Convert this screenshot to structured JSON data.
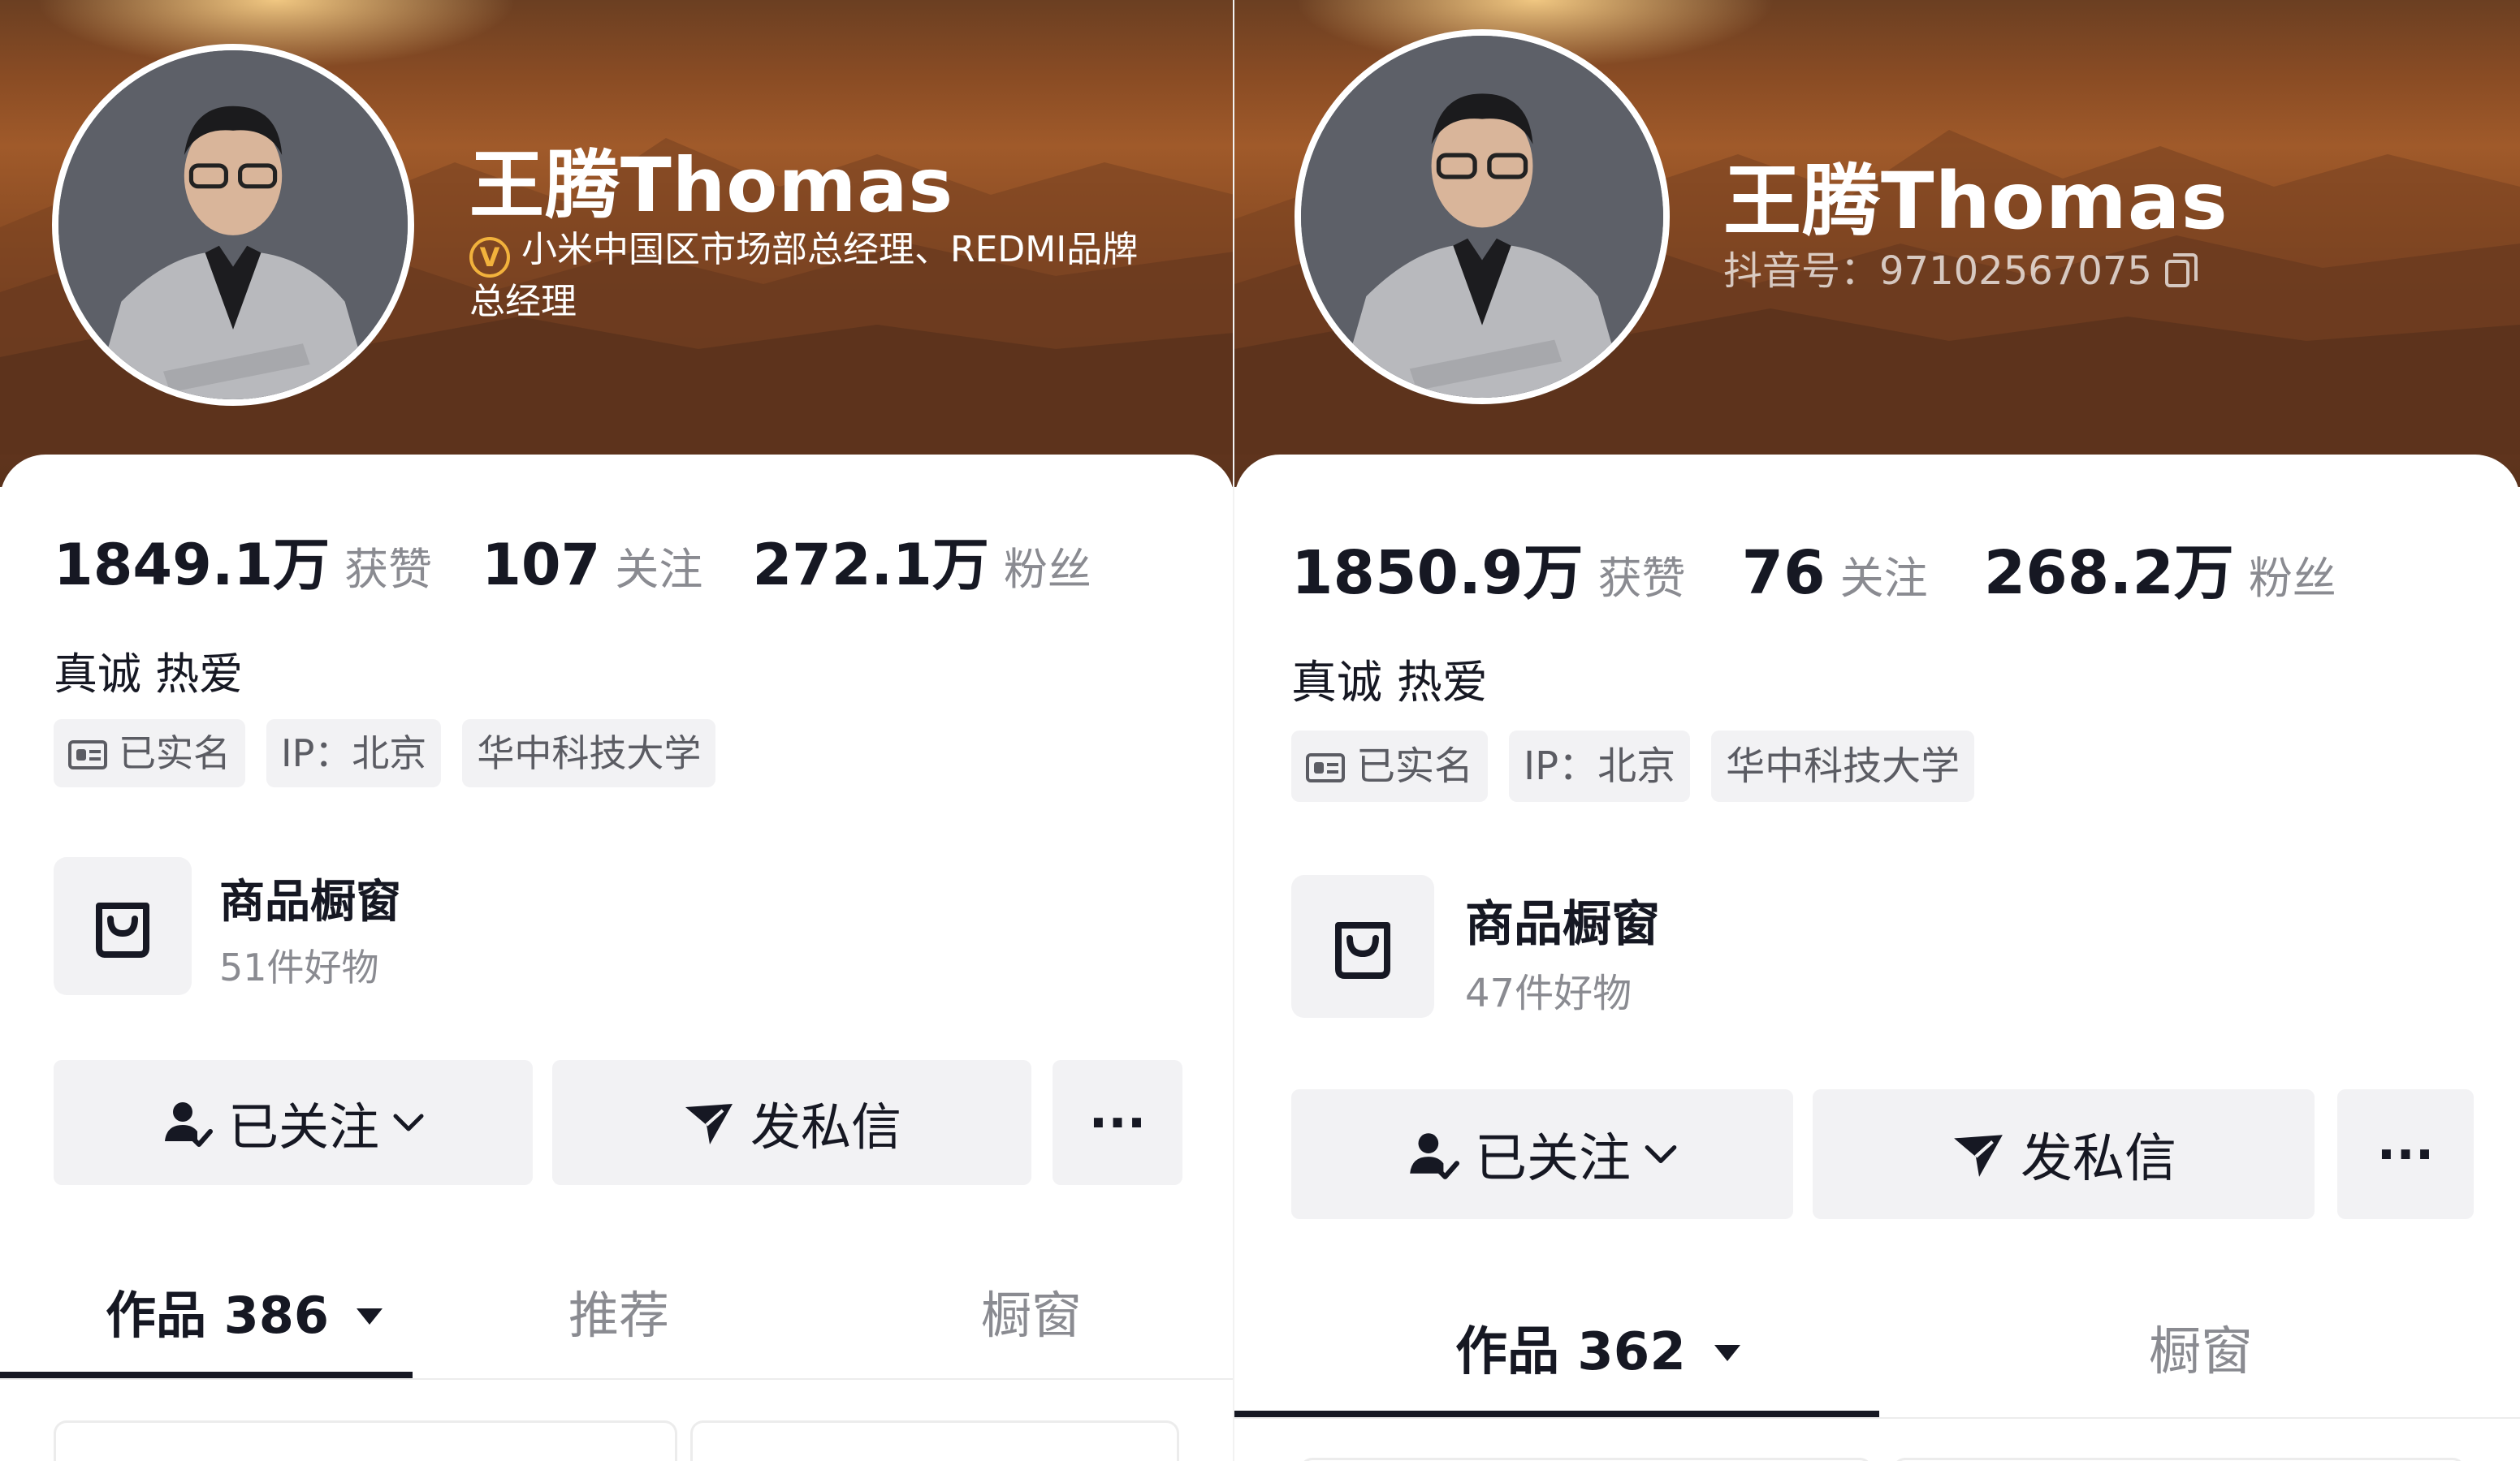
{
  "left": {
    "name": "王腾Thomas",
    "verified_mark": "V",
    "verification_text": "小米中国区市场部总经理、REDMI品牌总经理",
    "stats": [
      {
        "value": "1849.1万",
        "label": "获赞"
      },
      {
        "value": "107",
        "label": "关注"
      },
      {
        "value": "272.1万",
        "label": "粉丝"
      }
    ],
    "motto": "真诚 热爱",
    "tags": [
      "已实名",
      "IP：北京",
      "华中科技大学"
    ],
    "shop": {
      "title": "商品橱窗",
      "count": "51件好物"
    },
    "buttons": {
      "follow": "已关注",
      "message": "发私信",
      "more": "···"
    },
    "tabs": [
      {
        "label": "作品 386",
        "active": true
      },
      {
        "label": "推荐",
        "active": false
      },
      {
        "label": "橱窗",
        "active": false
      }
    ]
  },
  "right": {
    "name": "王腾Thomas",
    "douyin_id": "抖音号：97102567075",
    "stats": [
      {
        "value": "1850.9万",
        "label": "获赞"
      },
      {
        "value": "76",
        "label": "关注"
      },
      {
        "value": "268.2万",
        "label": "粉丝"
      }
    ],
    "motto": "真诚 热爱",
    "tags": [
      "已实名",
      "IP：北京",
      "华中科技大学"
    ],
    "shop": {
      "title": "商品橱窗",
      "count": "47件好物"
    },
    "buttons": {
      "follow": "已关注",
      "message": "发私信",
      "more": "···"
    },
    "tabs": [
      {
        "label": "作品 362",
        "active": true
      },
      {
        "label": "橱窗",
        "active": false
      }
    ]
  },
  "icons": [
    "verified-icon",
    "id-card-icon",
    "shopping-bag-icon",
    "user-check-icon",
    "chevron-down-icon",
    "send-icon",
    "more-icon",
    "dropdown-triangle-icon",
    "copy-icon"
  ],
  "colors": {
    "banner": "#8a4c24",
    "badge_gold": "#f2b23c",
    "text_primary": "#161823",
    "text_secondary": "#8a8b91",
    "chip_bg": "#f2f2f4"
  }
}
